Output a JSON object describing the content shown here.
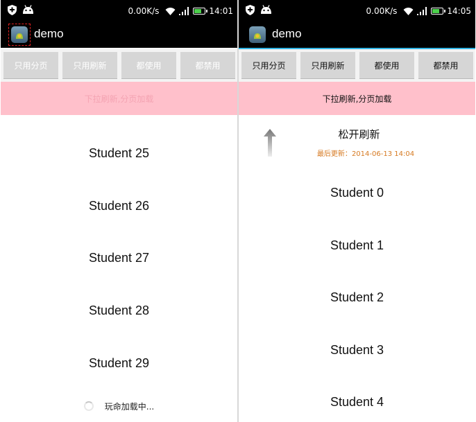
{
  "status_bar": {
    "left": {
      "speed": "0.00K/s",
      "time": "14:01"
    },
    "right": {
      "speed": "0.00K/s",
      "time": "14:05"
    }
  },
  "app": {
    "title": "demo"
  },
  "buttons": [
    "只用分页",
    "只用刷新",
    "都使用",
    "都禁用"
  ],
  "banner_text": "下拉刷新,分页加载",
  "left_list": [
    "Student 25",
    "Student 26",
    "Student 27",
    "Student 28",
    "Student 29"
  ],
  "loading_text": "玩命加载中...",
  "pull_header": {
    "title": "松开刷新",
    "time_label": "最后更新：",
    "time_value": "2014-06-13 14:04"
  },
  "right_list": [
    "Student 0",
    "Student 1",
    "Student 2",
    "Student 3",
    "Student 4"
  ],
  "colors": {
    "status_bar_bg": "#000000",
    "action_bar_accent": "#33b5e5",
    "banner_bg": "#ffc0cb",
    "button_bg": "#d6d6d6",
    "pull_time_text": "#d67a22"
  },
  "icons": [
    "shield-icon",
    "android-icon",
    "wifi-icon",
    "signal-icon",
    "battery-icon",
    "app-icon",
    "spinner-icon",
    "pull-arrow-icon"
  ]
}
